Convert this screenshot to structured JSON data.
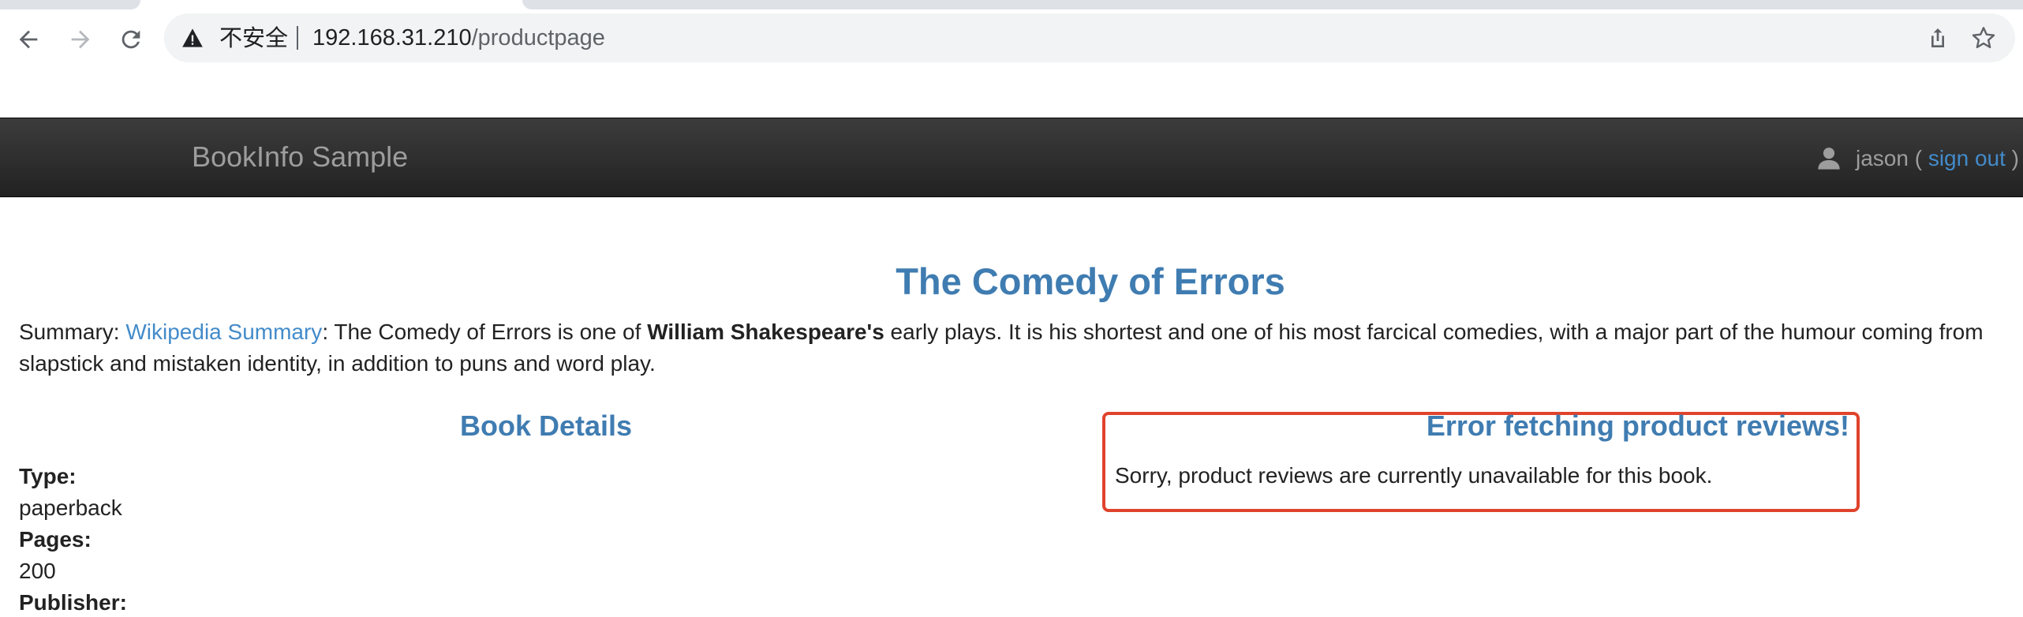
{
  "browser": {
    "security_label": "不安全",
    "url_host": "192.168.31.210",
    "url_path": "/productpage",
    "icons": [
      "back-arrow-icon",
      "forward-arrow-icon",
      "reload-icon",
      "warning-icon",
      "share-icon",
      "star-icon"
    ]
  },
  "navbar": {
    "brand": "BookInfo Sample",
    "username": "jason",
    "open_paren": "(",
    "sign_out": "sign out",
    "close_paren": ")"
  },
  "book": {
    "title": "The Comedy of Errors",
    "summary_label": "Summary:",
    "summary_link": "Wikipedia Summary",
    "summary_text_1": ": The Comedy of Errors is one of ",
    "summary_author": "William Shakespeare's",
    "summary_text_2": " early plays. It is his shortest and one of his most farcical comedies, with a major part of the humour coming from slapstick and mistaken identity, in addition to puns and word play."
  },
  "details": {
    "heading": "Book Details",
    "type_label": "Type:",
    "type_value": "paperback",
    "pages_label": "Pages:",
    "pages_value": "200",
    "publisher_label": "Publisher:"
  },
  "reviews": {
    "error_heading": "Error fetching product reviews!",
    "error_message": "Sorry, product reviews are currently unavailable for this book."
  },
  "colors": {
    "link": "#428bca",
    "heading": "#3f7cb1",
    "navbar_bg": "#222222",
    "error_border": "#e0432c"
  }
}
